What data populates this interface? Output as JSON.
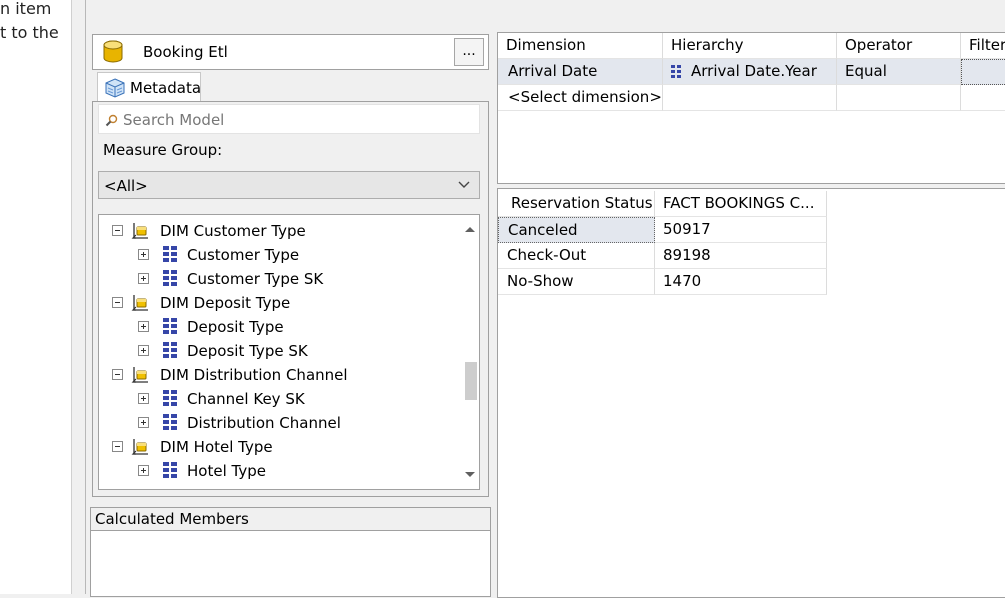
{
  "left_strip": {
    "line1": "n item",
    "line2": "t to the"
  },
  "cube": {
    "name": "Booking Etl",
    "browse_label": "..."
  },
  "metadata_tab": {
    "label": "Metadata"
  },
  "search": {
    "placeholder": "Search Model"
  },
  "measure_group": {
    "label": "Measure Group:",
    "value": "<All>"
  },
  "tree": {
    "items": [
      {
        "level": 0,
        "label": "DIM Customer Type"
      },
      {
        "level": 1,
        "label": "Customer Type"
      },
      {
        "level": 1,
        "label": "Customer Type SK"
      },
      {
        "level": 0,
        "label": "DIM Deposit Type"
      },
      {
        "level": 1,
        "label": "Deposit Type"
      },
      {
        "level": 1,
        "label": "Deposit Type SK"
      },
      {
        "level": 0,
        "label": "DIM Distribution Channel"
      },
      {
        "level": 1,
        "label": "Channel Key SK"
      },
      {
        "level": 1,
        "label": "Distribution Channel"
      },
      {
        "level": 0,
        "label": "DIM Hotel Type"
      },
      {
        "level": 1,
        "label": "Hotel Type"
      }
    ]
  },
  "calculated_members": {
    "title": "Calculated Members"
  },
  "filter_grid": {
    "headers": [
      "Dimension",
      "Hierarchy",
      "Operator",
      "Filter"
    ],
    "rows": [
      {
        "dimension": "Arrival Date",
        "hierarchy": "Arrival Date.Year",
        "operator": "Equal",
        "filter": ""
      },
      {
        "dimension": "<Select dimension>",
        "hierarchy": "",
        "operator": "",
        "filter": ""
      }
    ]
  },
  "results": {
    "headers": [
      "Reservation Status",
      "FACT BOOKINGS C..."
    ],
    "rows": [
      {
        "status": "Canceled",
        "value": "50917"
      },
      {
        "status": "Check-Out",
        "value": "89198"
      },
      {
        "status": "No-Show",
        "value": "1470"
      }
    ]
  },
  "colors": {
    "selected_row": "#e3e7ee",
    "cube_icon": "#f0c000",
    "hierarchy_icon": "#3646a8"
  }
}
